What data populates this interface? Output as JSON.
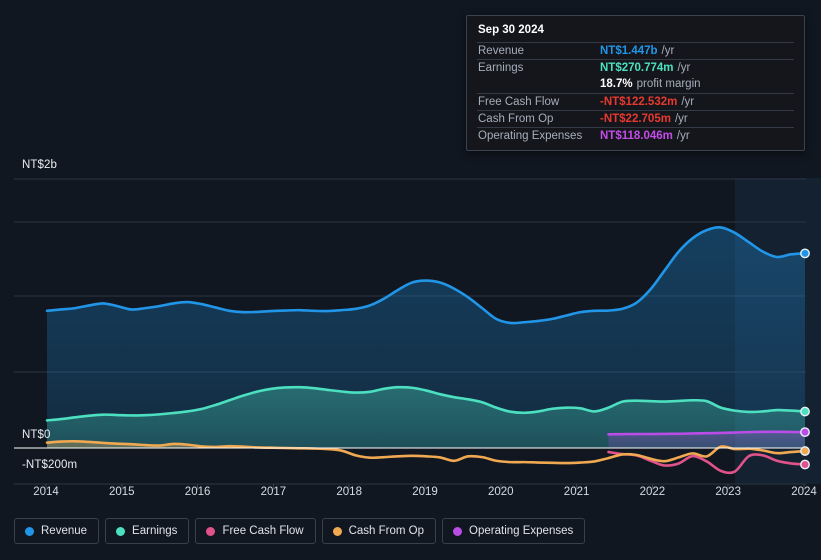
{
  "chart_data": {
    "type": "area",
    "title": "",
    "xlabel": "",
    "ylabel": "",
    "grid": true,
    "legend_position": "bottom",
    "x_ticks": [
      "2014",
      "2015",
      "2016",
      "2017",
      "2018",
      "2019",
      "2020",
      "2021",
      "2022",
      "2023",
      "2024"
    ],
    "y_ticks": [
      "NT$2b",
      "NT$0",
      "-NT$200m"
    ],
    "ylim": [
      -200,
      2000
    ],
    "y_unit": "NT$ millions",
    "series": [
      {
        "name": "Revenue",
        "color": "#2196e8",
        "values": [
          1020,
          1030,
          1040,
          1060,
          1075,
          1055,
          1030,
          1040,
          1055,
          1075,
          1085,
          1070,
          1045,
          1020,
          1010,
          1012,
          1018,
          1022,
          1025,
          1020,
          1018,
          1025,
          1035,
          1060,
          1110,
          1175,
          1230,
          1245,
          1230,
          1185,
          1120,
          1040,
          960,
          930,
          935,
          945,
          960,
          985,
          1010,
          1020,
          1022,
          1035,
          1080,
          1180,
          1320,
          1460,
          1560,
          1620,
          1640,
          1600,
          1530,
          1460,
          1420,
          1440,
          1447
        ],
        "end_value": 1447
      },
      {
        "name": "Earnings",
        "color": "#4ce0c0",
        "values": [
          205,
          215,
          228,
          240,
          248,
          245,
          242,
          244,
          250,
          260,
          272,
          290,
          320,
          355,
          390,
          420,
          440,
          450,
          452,
          445,
          432,
          420,
          412,
          418,
          440,
          452,
          448,
          428,
          400,
          378,
          362,
          340,
          300,
          270,
          262,
          272,
          292,
          300,
          295,
          272,
          300,
          345,
          352,
          348,
          345,
          350,
          355,
          348,
          300,
          278,
          268,
          272,
          282,
          278,
          271
        ],
        "end_value": 270.774
      },
      {
        "name": "Free Cash Flow",
        "color": "#e0538a",
        "values": [
          null,
          null,
          null,
          null,
          null,
          null,
          null,
          null,
          null,
          null,
          null,
          null,
          null,
          null,
          null,
          null,
          null,
          null,
          null,
          null,
          null,
          null,
          null,
          null,
          null,
          null,
          null,
          null,
          null,
          null,
          null,
          null,
          null,
          null,
          null,
          null,
          null,
          null,
          null,
          null,
          -30,
          -45,
          -55,
          -95,
          -130,
          -115,
          -60,
          -100,
          -170,
          -175,
          -60,
          -55,
          -95,
          -115,
          -122.532
        ],
        "end_value": -122.532
      },
      {
        "name": "Cash From Op",
        "color": "#f0a952",
        "values": [
          40,
          48,
          50,
          45,
          38,
          32,
          28,
          22,
          18,
          30,
          25,
          12,
          8,
          14,
          10,
          4,
          2,
          0,
          -2,
          -4,
          -8,
          -20,
          -55,
          -72,
          -68,
          -62,
          -58,
          -62,
          -70,
          -95,
          -62,
          -68,
          -95,
          -105,
          -105,
          -108,
          -110,
          -112,
          -108,
          -100,
          -75,
          -48,
          -52,
          -80,
          -98,
          -70,
          -40,
          -62,
          10,
          -8,
          -5,
          -18,
          -38,
          -30,
          -22.705
        ],
        "end_value": -22.705
      },
      {
        "name": "Operating Expenses",
        "color": "#ba4ce8",
        "values": [
          null,
          null,
          null,
          null,
          null,
          null,
          null,
          null,
          null,
          null,
          null,
          null,
          null,
          null,
          null,
          null,
          null,
          null,
          null,
          null,
          null,
          null,
          null,
          null,
          null,
          null,
          null,
          null,
          null,
          null,
          null,
          null,
          null,
          null,
          null,
          null,
          null,
          null,
          null,
          null,
          102,
          103,
          104,
          104,
          105,
          106,
          108,
          110,
          112,
          115,
          118,
          120,
          120,
          119,
          118.046
        ],
        "end_value": 118.046
      }
    ]
  },
  "tooltip": {
    "title": "Sep 30 2024",
    "rows": [
      {
        "label": "Revenue",
        "value": "NT$1.447b",
        "unit": "/yr",
        "color": "#2196e8"
      },
      {
        "label": "Earnings",
        "value": "NT$270.774m",
        "unit": "/yr",
        "color": "#4ce0c0"
      },
      {
        "label": "",
        "value": "18.7%",
        "unit": "profit margin",
        "color": "#ffffff",
        "margin_row": true
      },
      {
        "label": "Free Cash Flow",
        "value": "-NT$122.532m",
        "unit": "/yr",
        "color": "#e8392f"
      },
      {
        "label": "Cash From Op",
        "value": "-NT$22.705m",
        "unit": "/yr",
        "color": "#e8392f"
      },
      {
        "label": "Operating Expenses",
        "value": "NT$118.046m",
        "unit": "/yr",
        "color": "#c44ce8"
      }
    ]
  },
  "legend": {
    "items": [
      {
        "label": "Revenue",
        "color": "#2196e8"
      },
      {
        "label": "Earnings",
        "color": "#4ce0c0"
      },
      {
        "label": "Free Cash Flow",
        "color": "#e0538a"
      },
      {
        "label": "Cash From Op",
        "color": "#f0a952"
      },
      {
        "label": "Operating Expenses",
        "color": "#ba4ce8"
      }
    ]
  },
  "axis": {
    "y_top_label": "NT$2b",
    "y_zero_label": "NT$0",
    "y_bottom_label": "-NT$200m"
  }
}
